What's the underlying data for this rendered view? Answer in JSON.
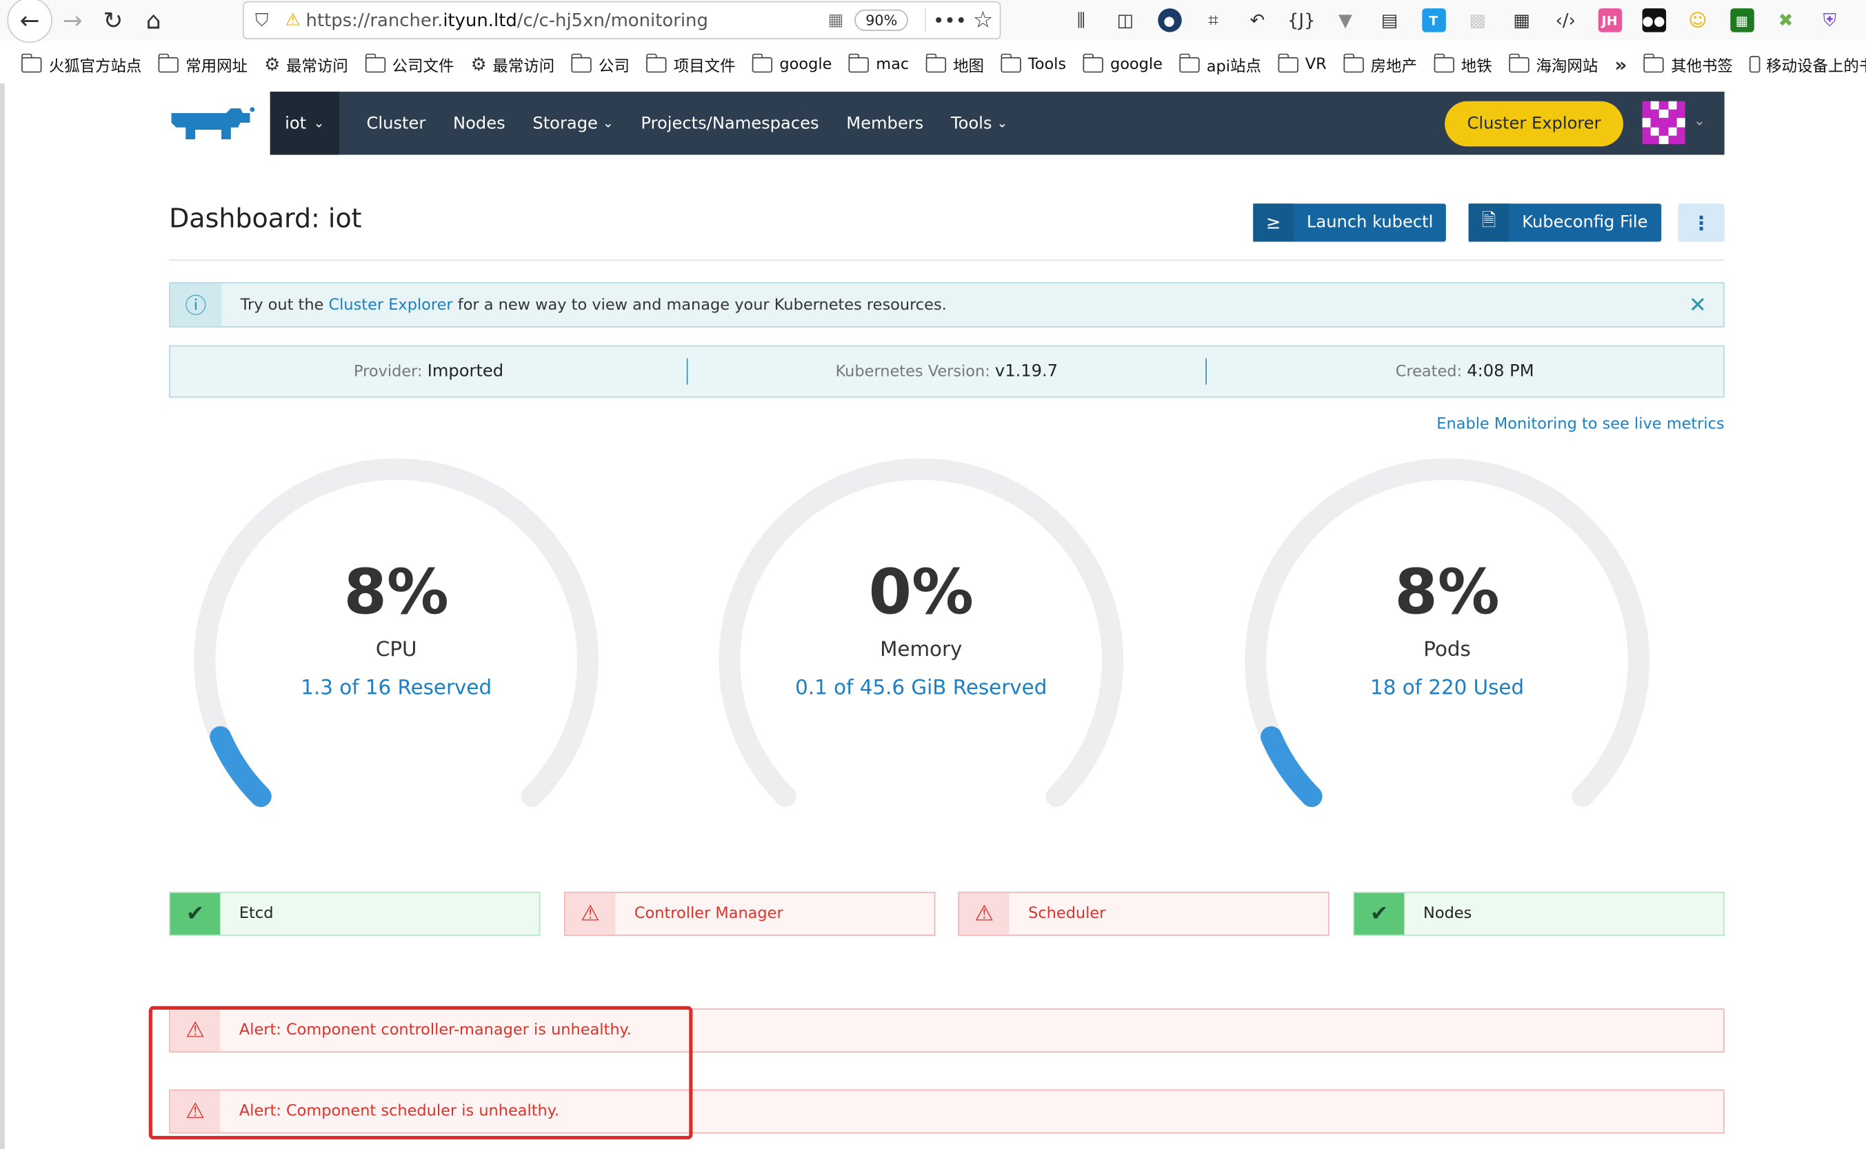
{
  "browser": {
    "url_prefix": "https://rancher.",
    "url_domain": "ityun.ltd",
    "url_path": "/c/c-hj5xn/monitoring",
    "zoom": "90%",
    "ext_labels": [
      "{J}",
      "T",
      "JH"
    ]
  },
  "bookmarks": [
    {
      "type": "folder",
      "label": "火狐官方站点"
    },
    {
      "type": "folder",
      "label": "常用网址"
    },
    {
      "type": "gear",
      "label": "最常访问"
    },
    {
      "type": "folder",
      "label": "公司文件"
    },
    {
      "type": "gear",
      "label": "最常访问"
    },
    {
      "type": "folder",
      "label": "公司"
    },
    {
      "type": "folder",
      "label": "项目文件"
    },
    {
      "type": "folder",
      "label": "google"
    },
    {
      "type": "folder",
      "label": "mac"
    },
    {
      "type": "folder",
      "label": "地图"
    },
    {
      "type": "folder",
      "label": "Tools"
    },
    {
      "type": "folder",
      "label": "google"
    },
    {
      "type": "folder",
      "label": "api站点"
    },
    {
      "type": "folder",
      "label": "VR"
    },
    {
      "type": "folder",
      "label": "房地产"
    },
    {
      "type": "folder",
      "label": "地铁"
    },
    {
      "type": "folder",
      "label": "海淘网站"
    },
    {
      "type": "overflow",
      "label": "»"
    },
    {
      "type": "folder",
      "label": "其他书签"
    },
    {
      "type": "device",
      "label": "移动设备上的书签"
    }
  ],
  "nav": {
    "cluster": "iot",
    "items": [
      "Cluster",
      "Nodes",
      "Storage",
      "Projects/Namespaces",
      "Members",
      "Tools"
    ],
    "explorer_button": "Cluster Explorer"
  },
  "page": {
    "title": "Dashboard: iot",
    "launch_kubectl": "Launch kubectl",
    "kubeconfig": "Kubeconfig File",
    "kubectl_icon_glyph": "≥"
  },
  "banner": {
    "before": "Try out the ",
    "link": "Cluster Explorer",
    "after": " for a new way to view and manage your Kubernetes resources."
  },
  "meta": {
    "provider_label": "Provider:",
    "provider": "Imported",
    "version_label": "Kubernetes Version:",
    "version": "v1.19.7",
    "created_label": "Created:",
    "created": "4:08 PM"
  },
  "monitoring_link": "Enable Monitoring to see live metrics",
  "gauges": [
    {
      "percent_text": "8%",
      "value": 8,
      "label": "CPU",
      "sub": "1.3 of 16 Reserved"
    },
    {
      "percent_text": "0%",
      "value": 0,
      "label": "Memory",
      "sub": "0.1 of 45.6 GiB Reserved"
    },
    {
      "percent_text": "8%",
      "value": 8,
      "label": "Pods",
      "sub": "18 of 220 Used"
    }
  ],
  "components": [
    {
      "label": "Etcd",
      "status": "ok"
    },
    {
      "label": "Controller Manager",
      "status": "error"
    },
    {
      "label": "Scheduler",
      "status": "error"
    },
    {
      "label": "Nodes",
      "status": "ok"
    }
  ],
  "alerts": [
    "Alert: Component controller-manager is unhealthy.",
    "Alert: Component scheduler is unhealthy."
  ],
  "colors": {
    "navbar": "#2c3e50",
    "accent_yellow": "#f2c70e",
    "primary_blue": "#1565a0",
    "link_blue": "#1a7fc4",
    "gauge_fill": "#3a97de",
    "gauge_track": "#eceeef",
    "error_red": "#d9342b",
    "ok_green": "#5dc778"
  }
}
